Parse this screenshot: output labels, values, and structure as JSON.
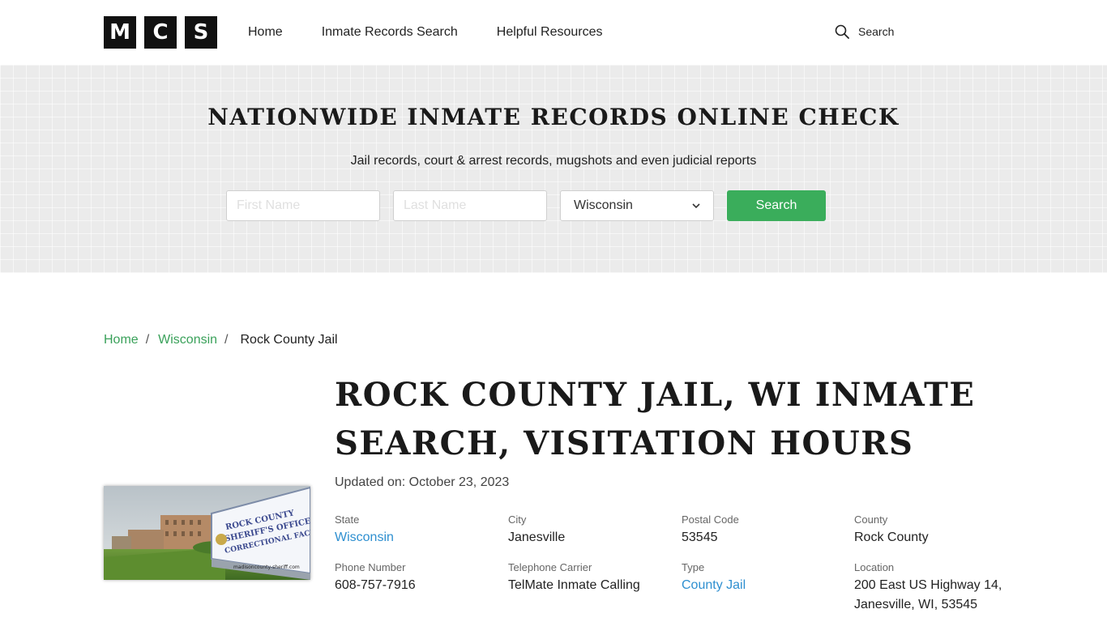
{
  "header": {
    "logo_letters": [
      "M",
      "C",
      "S"
    ],
    "nav": [
      "Home",
      "Inmate Records Search",
      "Helpful Resources"
    ],
    "search_label": "Search"
  },
  "hero": {
    "title": "NATIONWIDE INMATE RECORDS ONLINE CHECK",
    "subtitle": "Jail records, court & arrest records, mugshots and even judicial reports",
    "first_name_placeholder": "First Name",
    "last_name_placeholder": "Last Name",
    "state_selected": "Wisconsin",
    "search_button": "Search"
  },
  "breadcrumb": {
    "home": "Home",
    "state": "Wisconsin",
    "current": "Rock County Jail",
    "separator": "/"
  },
  "photo": {
    "sign_lines": [
      "ROCK COUNTY",
      "SHERIFF'S OFFICE &",
      "CORRECTIONAL FACILITY"
    ],
    "watermark": "madisoncounty-sheriff.com"
  },
  "main": {
    "title": "ROCK COUNTY JAIL, WI INMATE SEARCH, VISITATION HOURS",
    "updated_label": "Updated on:",
    "updated_date": "October 23, 2023",
    "fields": [
      {
        "key": "State",
        "value": "Wisconsin",
        "link": true
      },
      {
        "key": "City",
        "value": "Janesville",
        "link": false
      },
      {
        "key": "Postal Code",
        "value": "53545",
        "link": false
      },
      {
        "key": "County",
        "value": "Rock County",
        "link": false
      },
      {
        "key": "Phone Number",
        "value": "608-757-7916",
        "link": false
      },
      {
        "key": "Telephone Carrier",
        "value": "TelMate Inmate Calling",
        "link": false
      },
      {
        "key": "Type",
        "value": "County Jail",
        "link": true
      },
      {
        "key": "Location",
        "value": "200 East US Highway 14,",
        "value2": "Janesville, WI, 53545",
        "link": false
      }
    ]
  },
  "colors": {
    "accent_green": "#3aad5b",
    "link_blue": "#2e8fd0",
    "breadcrumb_green": "#3aa15a"
  }
}
